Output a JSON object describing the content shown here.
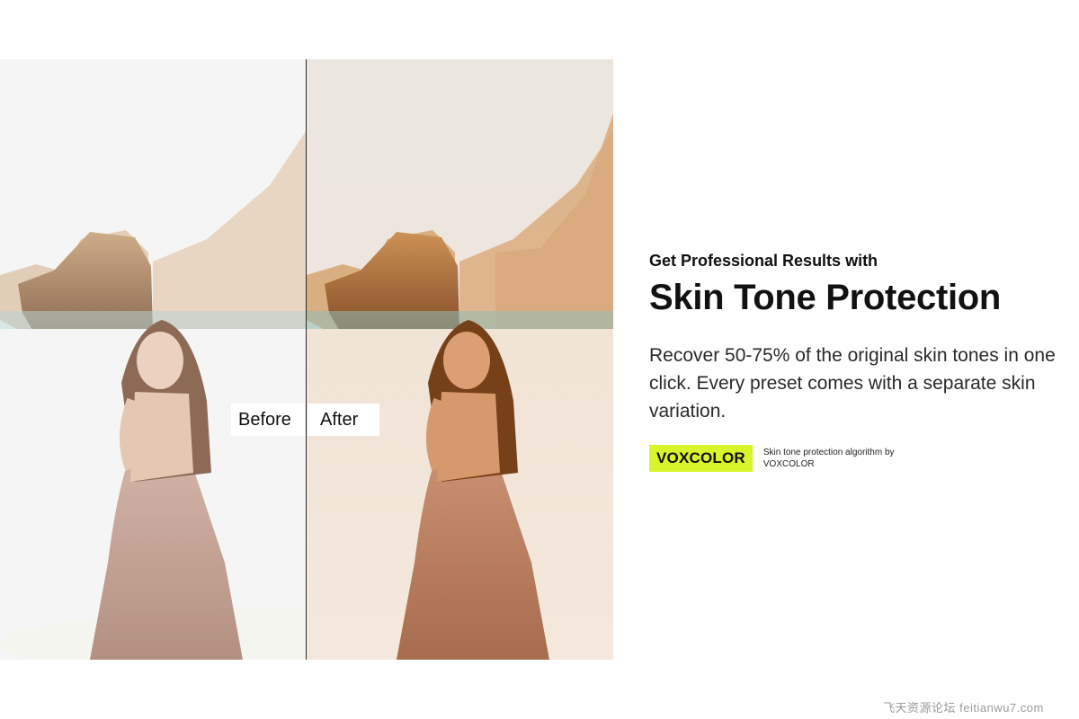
{
  "comparison": {
    "before_label": "Before",
    "after_label": "After"
  },
  "copy": {
    "kicker": "Get Professional Results with",
    "headline": "Skin Tone Protection",
    "body": "Recover 50-75% of the original skin tones in one click.  Every preset comes with a separate skin variation.",
    "brand_badge": "VOXCOLOR",
    "brand_note": "Skin tone protection algorithm by VOXCOLOR"
  },
  "watermark": "飞天资源论坛 feitianwu7.com",
  "colors": {
    "badge": "#d8f52c",
    "text": "#111111",
    "background": "#ffffff"
  }
}
